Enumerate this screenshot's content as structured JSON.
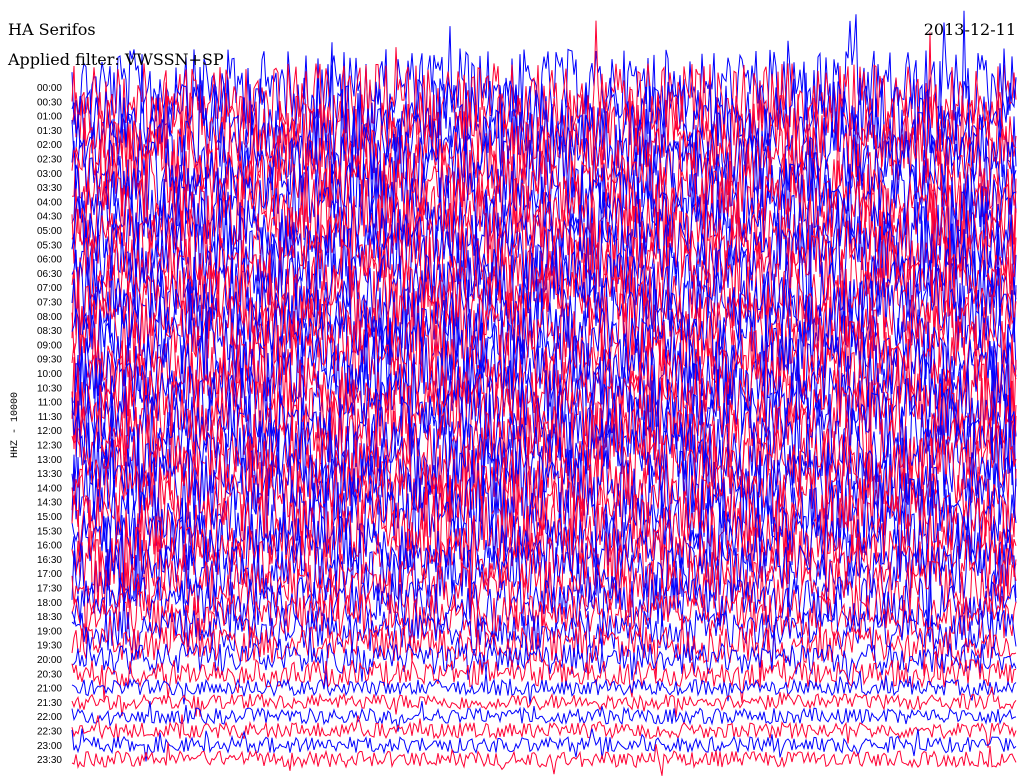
{
  "header": {
    "station": "HA Serifos",
    "date": "2013-12-11",
    "filter": "Applied filter: VWSSN+SP"
  },
  "chart_data": {
    "type": "line",
    "title": "HA Serifos",
    "ylabel": "HHZ - 10000",
    "tick_labels": [
      "00:00",
      "00:30",
      "01:00",
      "01:30",
      "02:00",
      "02:30",
      "03:00",
      "03:30",
      "04:00",
      "04:30",
      "05:00",
      "05:30",
      "06:00",
      "06:30",
      "07:00",
      "07:30",
      "08:00",
      "08:30",
      "09:00",
      "09:30",
      "10:00",
      "10:30",
      "11:00",
      "11:30",
      "12:00",
      "12:30",
      "13:00",
      "13:30",
      "14:00",
      "14:30",
      "15:00",
      "15:30",
      "16:00",
      "16:30",
      "17:00",
      "17:30",
      "18:00",
      "18:30",
      "19:00",
      "19:30",
      "20:00",
      "20:30",
      "21:00",
      "21:30",
      "22:00",
      "22:30",
      "23:00",
      "23:30"
    ],
    "trace_colors": [
      "#0000ff",
      "#ff0033"
    ],
    "colors": {
      "blue": "#0000ff",
      "red": "#ff0033"
    }
  }
}
